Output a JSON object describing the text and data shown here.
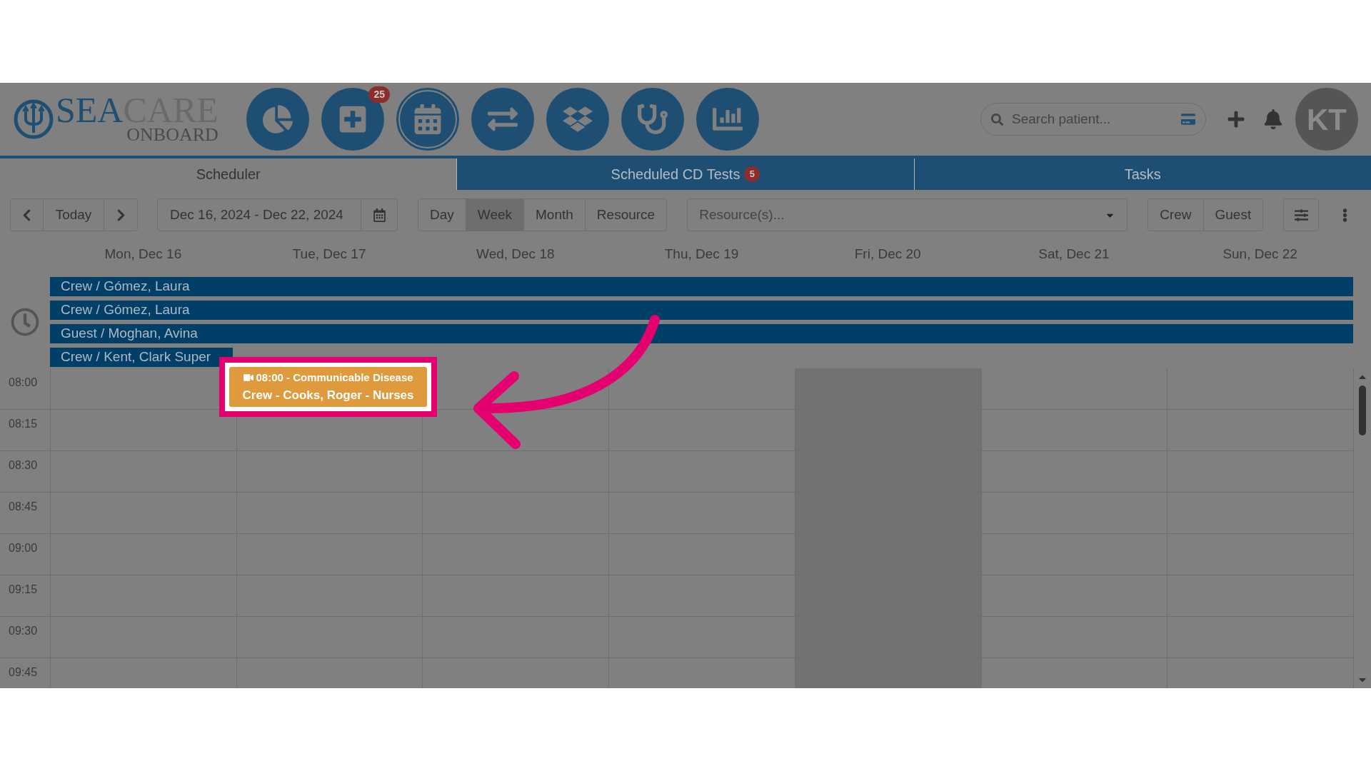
{
  "logo": {
    "brand_main": "SEA",
    "brand_accent": "CARE",
    "tagline": "ONBOARD"
  },
  "nav_icons": [
    {
      "kind": "pie",
      "selected": false
    },
    {
      "kind": "plus",
      "selected": false,
      "badge": "25"
    },
    {
      "kind": "calendar",
      "selected": true
    },
    {
      "kind": "transfer",
      "selected": false
    },
    {
      "kind": "boxes",
      "selected": false
    },
    {
      "kind": "stethoscope",
      "selected": false
    },
    {
      "kind": "bars",
      "selected": false
    }
  ],
  "search": {
    "placeholder": "Search patient..."
  },
  "avatar": "KT",
  "tabs": [
    {
      "label": "Scheduler",
      "selected": true
    },
    {
      "label": "Scheduled CD Tests",
      "selected": false,
      "badge": "5"
    },
    {
      "label": "Tasks",
      "selected": false
    }
  ],
  "toolbar": {
    "today": "Today",
    "date_range": "Dec 16, 2024 - Dec 22, 2024",
    "views": [
      {
        "label": "Day",
        "selected": false
      },
      {
        "label": "Week",
        "selected": true
      },
      {
        "label": "Month",
        "selected": false
      },
      {
        "label": "Resource",
        "selected": false
      }
    ],
    "resource_placeholder": "Resource(s)...",
    "filters": [
      {
        "label": "Crew"
      },
      {
        "label": "Guest"
      }
    ]
  },
  "days": [
    {
      "label": "Mon, Dec 16",
      "today": false
    },
    {
      "label": "Tue, Dec 17",
      "today": false,
      "events": [
        {
          "title": "08:00 - Communicable Disease",
          "subtitle": "Crew - Cooks, Roger - Nurses",
          "highlighted": true
        }
      ]
    },
    {
      "label": "Wed, Dec 18",
      "today": false
    },
    {
      "label": "Thu, Dec 19",
      "today": false
    },
    {
      "label": "Fri, Dec 20",
      "today": true
    },
    {
      "label": "Sat, Dec 21",
      "today": false
    },
    {
      "label": "Sun, Dec 22",
      "today": false
    }
  ],
  "all_day_events": [
    {
      "label": "Crew / Gómez, Laura",
      "full_week": true
    },
    {
      "label": "Crew / Gómez, Laura",
      "full_week": true
    },
    {
      "label": "Guest / Moghan, Avina",
      "full_week": true
    },
    {
      "label": "Crew / Kent, Clark Super",
      "full_week": false
    }
  ],
  "time_slots": [
    "08:00",
    "08:15",
    "08:30",
    "08:45",
    "09:00",
    "09:15",
    "09:30",
    "09:45"
  ]
}
